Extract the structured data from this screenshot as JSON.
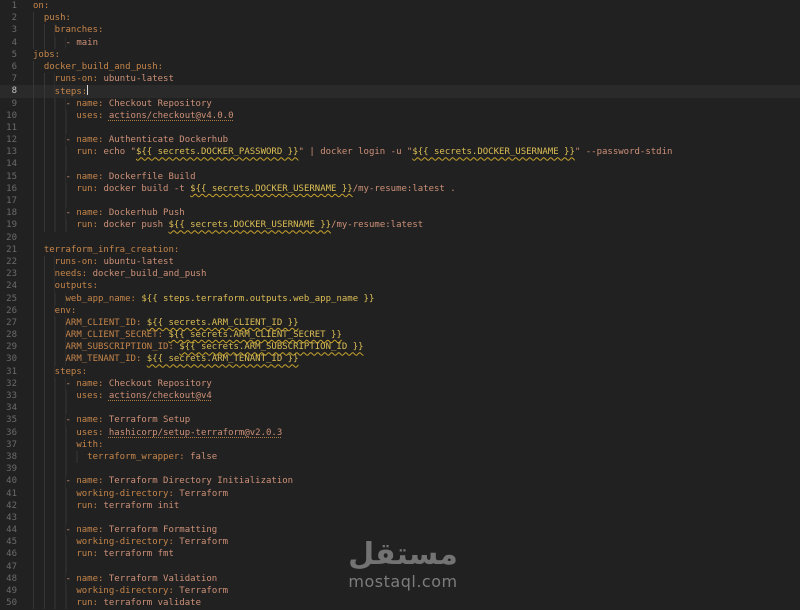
{
  "editor": {
    "language": "yaml",
    "content_description": "GitHub Actions workflow file",
    "active_line": 8,
    "colors": {
      "background": "#212121",
      "active_line_background": "#2a2a2a",
      "line_number": "#6b6b6b",
      "active_line_number": "#c6c6c6",
      "key": "#c5854a",
      "value": "#ce9178",
      "expression": "#dcbe55",
      "squiggle_underline": "#c9a42c",
      "link_underline": "#b27a45",
      "indent_guide": "#363636",
      "cursor": "#d8d8d8"
    },
    "lines": [
      {
        "n": 1,
        "indent": 0,
        "tokens": [
          [
            "k",
            "on:"
          ]
        ]
      },
      {
        "n": 2,
        "indent": 2,
        "tokens": [
          [
            "k",
            "push:"
          ]
        ]
      },
      {
        "n": 3,
        "indent": 4,
        "tokens": [
          [
            "k",
            "branches:"
          ]
        ]
      },
      {
        "n": 4,
        "indent": 6,
        "tokens": [
          [
            "v",
            "- main"
          ]
        ]
      },
      {
        "n": 5,
        "indent": 0,
        "tokens": [
          [
            "k",
            "jobs:"
          ]
        ]
      },
      {
        "n": 6,
        "indent": 2,
        "tokens": [
          [
            "k",
            "docker_build_and_push:"
          ]
        ]
      },
      {
        "n": 7,
        "indent": 4,
        "tokens": [
          [
            "k",
            "runs-on:"
          ],
          [
            "v",
            " ubuntu-latest"
          ]
        ]
      },
      {
        "n": 8,
        "indent": 4,
        "tokens": [
          [
            "k",
            "steps:"
          ]
        ]
      },
      {
        "n": 9,
        "indent": 6,
        "tokens": [
          [
            "v",
            "- "
          ],
          [
            "k",
            "name:"
          ],
          [
            "v",
            " Checkout Repository"
          ]
        ]
      },
      {
        "n": 10,
        "indent": 8,
        "tokens": [
          [
            "k",
            "uses:"
          ],
          [
            "v",
            " "
          ],
          [
            "l",
            "actions/checkout@v4.0.0"
          ]
        ]
      },
      {
        "n": 11,
        "indent": 8,
        "tokens": []
      },
      {
        "n": 12,
        "indent": 6,
        "tokens": [
          [
            "v",
            "- "
          ],
          [
            "k",
            "name:"
          ],
          [
            "v",
            " Authenticate Dockerhub"
          ]
        ]
      },
      {
        "n": 13,
        "indent": 8,
        "tokens": [
          [
            "k",
            "run:"
          ],
          [
            "v",
            " echo \""
          ],
          [
            "u",
            "${{ secrets.DOCKER_PASSWORD }}"
          ],
          [
            "v",
            "\" | docker login -u \""
          ],
          [
            "u",
            "${{ secrets.DOCKER_USERNAME }}"
          ],
          [
            "v",
            "\" --password-stdin"
          ]
        ]
      },
      {
        "n": 14,
        "indent": 8,
        "tokens": []
      },
      {
        "n": 15,
        "indent": 6,
        "tokens": [
          [
            "v",
            "- "
          ],
          [
            "k",
            "name:"
          ],
          [
            "v",
            " Dockerfile Build"
          ]
        ]
      },
      {
        "n": 16,
        "indent": 8,
        "tokens": [
          [
            "k",
            "run:"
          ],
          [
            "v",
            " docker build -t "
          ],
          [
            "u",
            "${{ secrets.DOCKER_USERNAME }}"
          ],
          [
            "v",
            "/my-resume:latest ."
          ]
        ]
      },
      {
        "n": 17,
        "indent": 8,
        "tokens": []
      },
      {
        "n": 18,
        "indent": 6,
        "tokens": [
          [
            "v",
            "- "
          ],
          [
            "k",
            "name:"
          ],
          [
            "v",
            " Dockerhub Push"
          ]
        ]
      },
      {
        "n": 19,
        "indent": 8,
        "tokens": [
          [
            "k",
            "run:"
          ],
          [
            "v",
            " docker push "
          ],
          [
            "u",
            "${{ secrets.DOCKER_USERNAME }}"
          ],
          [
            "v",
            "/my-resume:latest"
          ]
        ]
      },
      {
        "n": 20,
        "indent": 2,
        "tokens": []
      },
      {
        "n": 21,
        "indent": 2,
        "tokens": [
          [
            "k",
            "terraform_infra_creation:"
          ]
        ]
      },
      {
        "n": 22,
        "indent": 4,
        "tokens": [
          [
            "k",
            "runs-on:"
          ],
          [
            "v",
            " ubuntu-latest"
          ]
        ]
      },
      {
        "n": 23,
        "indent": 4,
        "tokens": [
          [
            "k",
            "needs:"
          ],
          [
            "v",
            " docker_build_and_push"
          ]
        ]
      },
      {
        "n": 24,
        "indent": 4,
        "tokens": [
          [
            "k",
            "outputs:"
          ]
        ]
      },
      {
        "n": 25,
        "indent": 6,
        "tokens": [
          [
            "k",
            "web_app_name:"
          ],
          [
            "v",
            " "
          ],
          [
            "e",
            "${{ steps.terraform.outputs.web_app_name }}"
          ]
        ]
      },
      {
        "n": 26,
        "indent": 4,
        "tokens": [
          [
            "k",
            "env:"
          ]
        ]
      },
      {
        "n": 27,
        "indent": 6,
        "tokens": [
          [
            "k",
            "ARM_CLIENT_ID:"
          ],
          [
            "v",
            " "
          ],
          [
            "u",
            "${{ secrets.ARM_CLIENT_ID }}"
          ]
        ]
      },
      {
        "n": 28,
        "indent": 6,
        "tokens": [
          [
            "k",
            "ARM_CLIENT_SECRET:"
          ],
          [
            "v",
            " "
          ],
          [
            "u",
            "${{ secrets.ARM_CLIENT_SECRET }}"
          ]
        ]
      },
      {
        "n": 29,
        "indent": 6,
        "tokens": [
          [
            "k",
            "ARM_SUBSCRIPTION_ID:"
          ],
          [
            "v",
            " "
          ],
          [
            "u",
            "${{ secrets.ARM_SUBSCRIPTION_ID }}"
          ]
        ]
      },
      {
        "n": 30,
        "indent": 6,
        "tokens": [
          [
            "k",
            "ARM_TENANT_ID:"
          ],
          [
            "v",
            " "
          ],
          [
            "u",
            "${{ secrets.ARM_TENANT_ID }}"
          ]
        ]
      },
      {
        "n": 31,
        "indent": 4,
        "tokens": [
          [
            "k",
            "steps:"
          ]
        ]
      },
      {
        "n": 32,
        "indent": 6,
        "tokens": [
          [
            "v",
            "- "
          ],
          [
            "k",
            "name:"
          ],
          [
            "v",
            " Checkout Repository"
          ]
        ]
      },
      {
        "n": 33,
        "indent": 8,
        "tokens": [
          [
            "k",
            "uses:"
          ],
          [
            "v",
            " "
          ],
          [
            "l",
            "actions/checkout@v4"
          ]
        ]
      },
      {
        "n": 34,
        "indent": 8,
        "tokens": []
      },
      {
        "n": 35,
        "indent": 6,
        "tokens": [
          [
            "v",
            "- "
          ],
          [
            "k",
            "name:"
          ],
          [
            "v",
            " Terraform Setup"
          ]
        ]
      },
      {
        "n": 36,
        "indent": 8,
        "tokens": [
          [
            "k",
            "uses:"
          ],
          [
            "v",
            " "
          ],
          [
            "l",
            "hashicorp/setup-terraform@v2.0.3"
          ]
        ]
      },
      {
        "n": 37,
        "indent": 8,
        "tokens": [
          [
            "k",
            "with:"
          ]
        ]
      },
      {
        "n": 38,
        "indent": 10,
        "tokens": [
          [
            "k",
            "terraform_wrapper:"
          ],
          [
            "v",
            " false"
          ]
        ]
      },
      {
        "n": 39,
        "indent": 8,
        "tokens": []
      },
      {
        "n": 40,
        "indent": 6,
        "tokens": [
          [
            "v",
            "- "
          ],
          [
            "k",
            "name:"
          ],
          [
            "v",
            " Terraform Directory Initialization"
          ]
        ]
      },
      {
        "n": 41,
        "indent": 8,
        "tokens": [
          [
            "k",
            "working-directory:"
          ],
          [
            "v",
            " Terraform"
          ]
        ]
      },
      {
        "n": 42,
        "indent": 8,
        "tokens": [
          [
            "k",
            "run:"
          ],
          [
            "v",
            " terraform init"
          ]
        ]
      },
      {
        "n": 43,
        "indent": 8,
        "tokens": []
      },
      {
        "n": 44,
        "indent": 6,
        "tokens": [
          [
            "v",
            "- "
          ],
          [
            "k",
            "name:"
          ],
          [
            "v",
            " Terraform Formatting"
          ]
        ]
      },
      {
        "n": 45,
        "indent": 8,
        "tokens": [
          [
            "k",
            "working-directory:"
          ],
          [
            "v",
            " Terraform"
          ]
        ]
      },
      {
        "n": 46,
        "indent": 8,
        "tokens": [
          [
            "k",
            "run:"
          ],
          [
            "v",
            " terraform fmt"
          ]
        ]
      },
      {
        "n": 47,
        "indent": 8,
        "tokens": []
      },
      {
        "n": 48,
        "indent": 6,
        "tokens": [
          [
            "v",
            "- "
          ],
          [
            "k",
            "name:"
          ],
          [
            "v",
            " Terraform Validation"
          ]
        ]
      },
      {
        "n": 49,
        "indent": 8,
        "tokens": [
          [
            "k",
            "working-directory:"
          ],
          [
            "v",
            " Terraform"
          ]
        ]
      },
      {
        "n": 50,
        "indent": 8,
        "tokens": [
          [
            "k",
            "run:"
          ],
          [
            "v",
            " terraform validate"
          ]
        ]
      }
    ]
  },
  "watermark": {
    "arabic": "مستقل",
    "domain": "mostaql.com"
  }
}
